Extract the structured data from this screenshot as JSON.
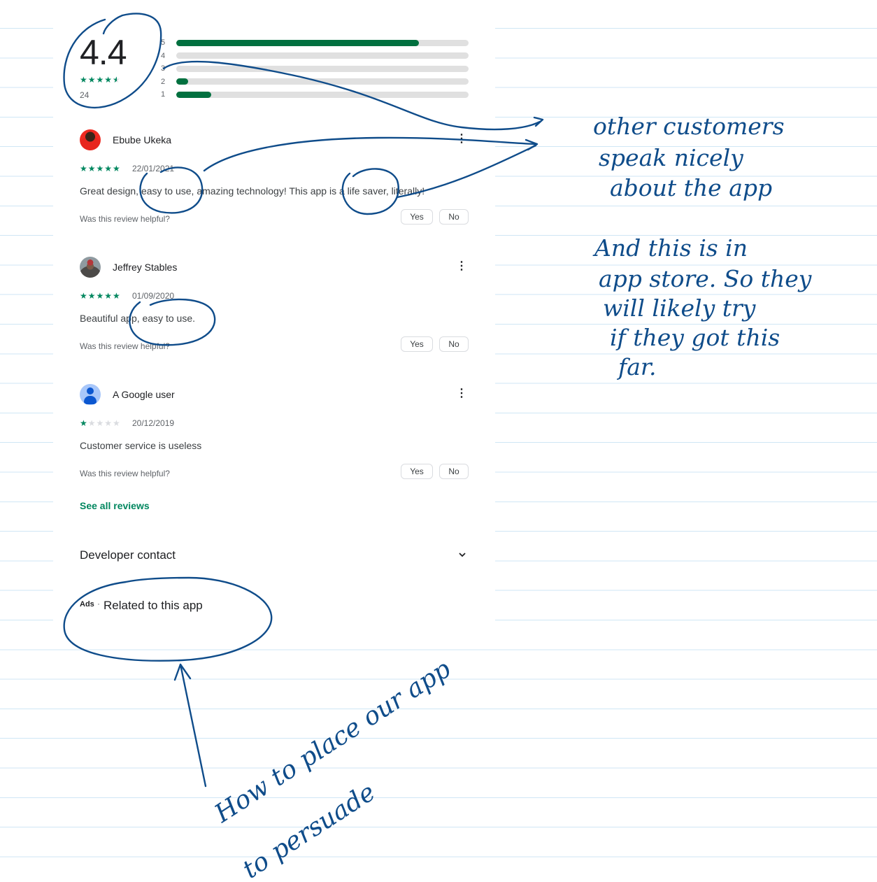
{
  "rating_summary": {
    "average": "4.4",
    "stars_filled": 4.4,
    "stars_display": "★★★★",
    "half_star": "★",
    "total_count": "24",
    "distribution": [
      {
        "label": "5",
        "fill_fraction": 0.83
      },
      {
        "label": "4",
        "fill_fraction": 0.0
      },
      {
        "label": "3",
        "fill_fraction": 0.0
      },
      {
        "label": "2",
        "fill_fraction": 0.04
      },
      {
        "label": "1",
        "fill_fraction": 0.12
      }
    ]
  },
  "reviews": [
    {
      "name": "Ebube Ukeka",
      "avatar": "photo-red-shirt",
      "stars_on": "★★★★★",
      "stars_off": "",
      "rating": 5,
      "date": "22/01/2021",
      "text": "Great design, easy to use, amazing technology! This app is a life saver, literally!",
      "helpful_prompt": "Was this review helpful?",
      "yes_label": "Yes",
      "no_label": "No",
      "more_icon": "⋮"
    },
    {
      "name": "Jeffrey Stables",
      "avatar": "photo-man",
      "stars_on": "★★★★★",
      "stars_off": "",
      "rating": 5,
      "date": "01/09/2020",
      "text": "Beautiful app, easy to use.",
      "helpful_prompt": "Was this review helpful?",
      "yes_label": "Yes",
      "no_label": "No",
      "more_icon": "⋮"
    },
    {
      "name": "A Google user",
      "avatar": "generic-person",
      "stars_on": "★",
      "stars_off": "★★★★",
      "rating": 1,
      "date": "20/12/2019",
      "text": "Customer service is useless",
      "helpful_prompt": "Was this review helpful?",
      "yes_label": "Yes",
      "no_label": "No",
      "more_icon": "⋮"
    }
  ],
  "see_all_reviews": "See all reviews",
  "developer_contact": {
    "label": "Developer contact",
    "icon": "chevron-down-icon"
  },
  "related": {
    "ads_label": "Ads",
    "separator": "·",
    "title": "Related to this app"
  },
  "colors": {
    "accent_green": "#01875f",
    "bar_fill": "#01703f",
    "bar_track": "#e0e0e0",
    "ink_blue": "#0f4c8a",
    "rule_line": "#cfe6f5"
  },
  "annotations": {
    "note1": [
      "other customers",
      "speak nicely",
      "about the app"
    ],
    "note2": [
      "And this is in",
      "app store. So they",
      "will likely try",
      "if they got this",
      "far."
    ],
    "note3": [
      "How to place our app",
      "to persuade"
    ]
  }
}
